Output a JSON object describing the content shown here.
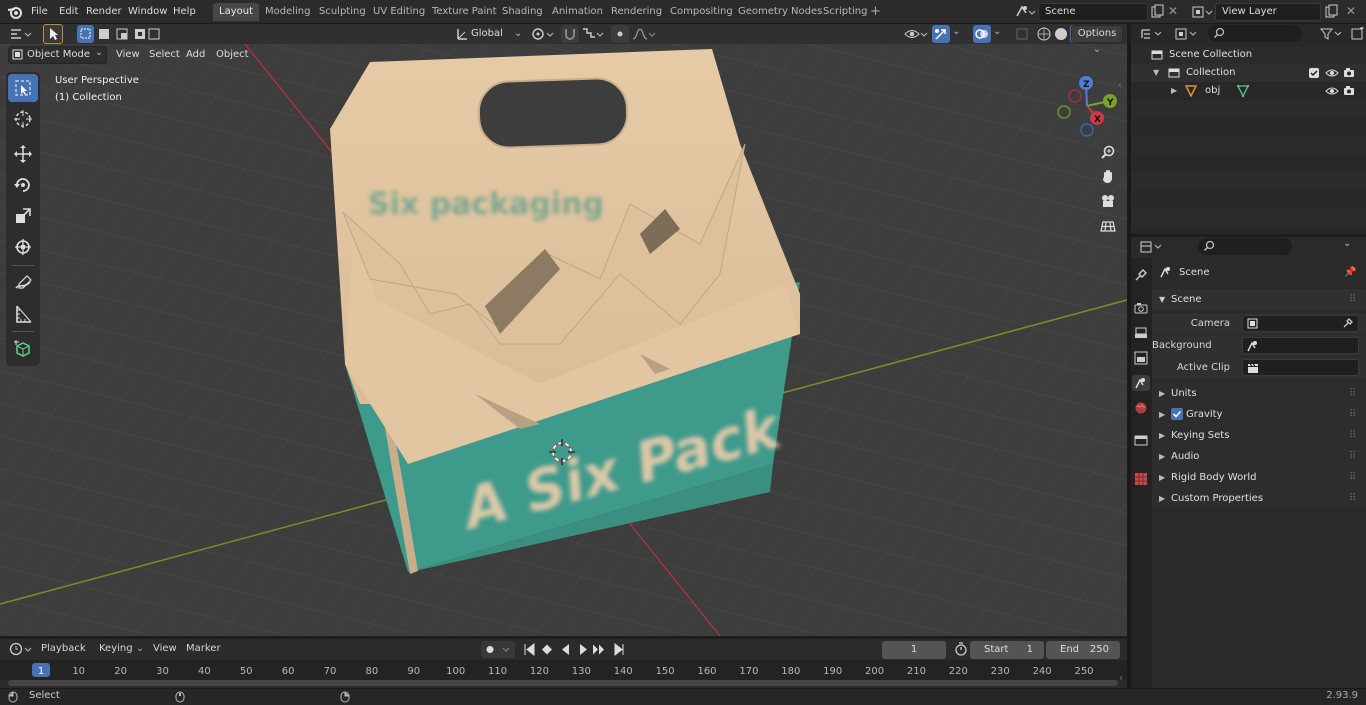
{
  "menus": [
    "File",
    "Edit",
    "Render",
    "Window",
    "Help"
  ],
  "workspaces": [
    "Layout",
    "Modeling",
    "Sculpting",
    "UV Editing",
    "Texture Paint",
    "Shading",
    "Animation",
    "Rendering",
    "Compositing",
    "Geometry Nodes",
    "Scripting"
  ],
  "active_workspace": "Layout",
  "scene_field": "Scene",
  "viewlayer_field": "View Layer",
  "viewport": {
    "mode": "Object Mode",
    "menus": [
      "View",
      "Select",
      "Add",
      "Object"
    ],
    "transform_orientation": "Global",
    "options_label": "Options",
    "perspective_label": "User Perspective",
    "collection_label": "(1) Collection",
    "model_text_front": "A Six Pack",
    "model_text_back": "Six packaging"
  },
  "outliner": {
    "scene_collection": "Scene Collection",
    "collection": "Collection",
    "object": "obj"
  },
  "properties": {
    "breadcrumb": "Scene",
    "section": "Scene",
    "camera_label": "Camera",
    "background_scene_label": "Background Scene",
    "active_clip_label": "Active Clip",
    "panels": [
      "Units",
      "Gravity",
      "Keying Sets",
      "Audio",
      "Rigid Body World",
      "Custom Properties"
    ],
    "gravity_checked": true
  },
  "timeline": {
    "menus": [
      "Playback",
      "Keying",
      "View",
      "Marker"
    ],
    "current_frame": "1",
    "start_label": "Start",
    "start_value": "1",
    "end_label": "End",
    "end_value": "250",
    "ruler": [
      "1",
      "10",
      "20",
      "30",
      "40",
      "50",
      "60",
      "70",
      "80",
      "90",
      "100",
      "110",
      "120",
      "130",
      "140",
      "150",
      "160",
      "170",
      "180",
      "190",
      "200",
      "210",
      "220",
      "230",
      "240",
      "250"
    ]
  },
  "status": {
    "left": "Select",
    "version": "2.93.9"
  },
  "colors": {
    "accent": "#4772b3",
    "x_axis": "#c0343e",
    "y_axis": "#7aa22b",
    "box_teal": "#4aa393",
    "box_cardboard": "#e3c9a6"
  }
}
